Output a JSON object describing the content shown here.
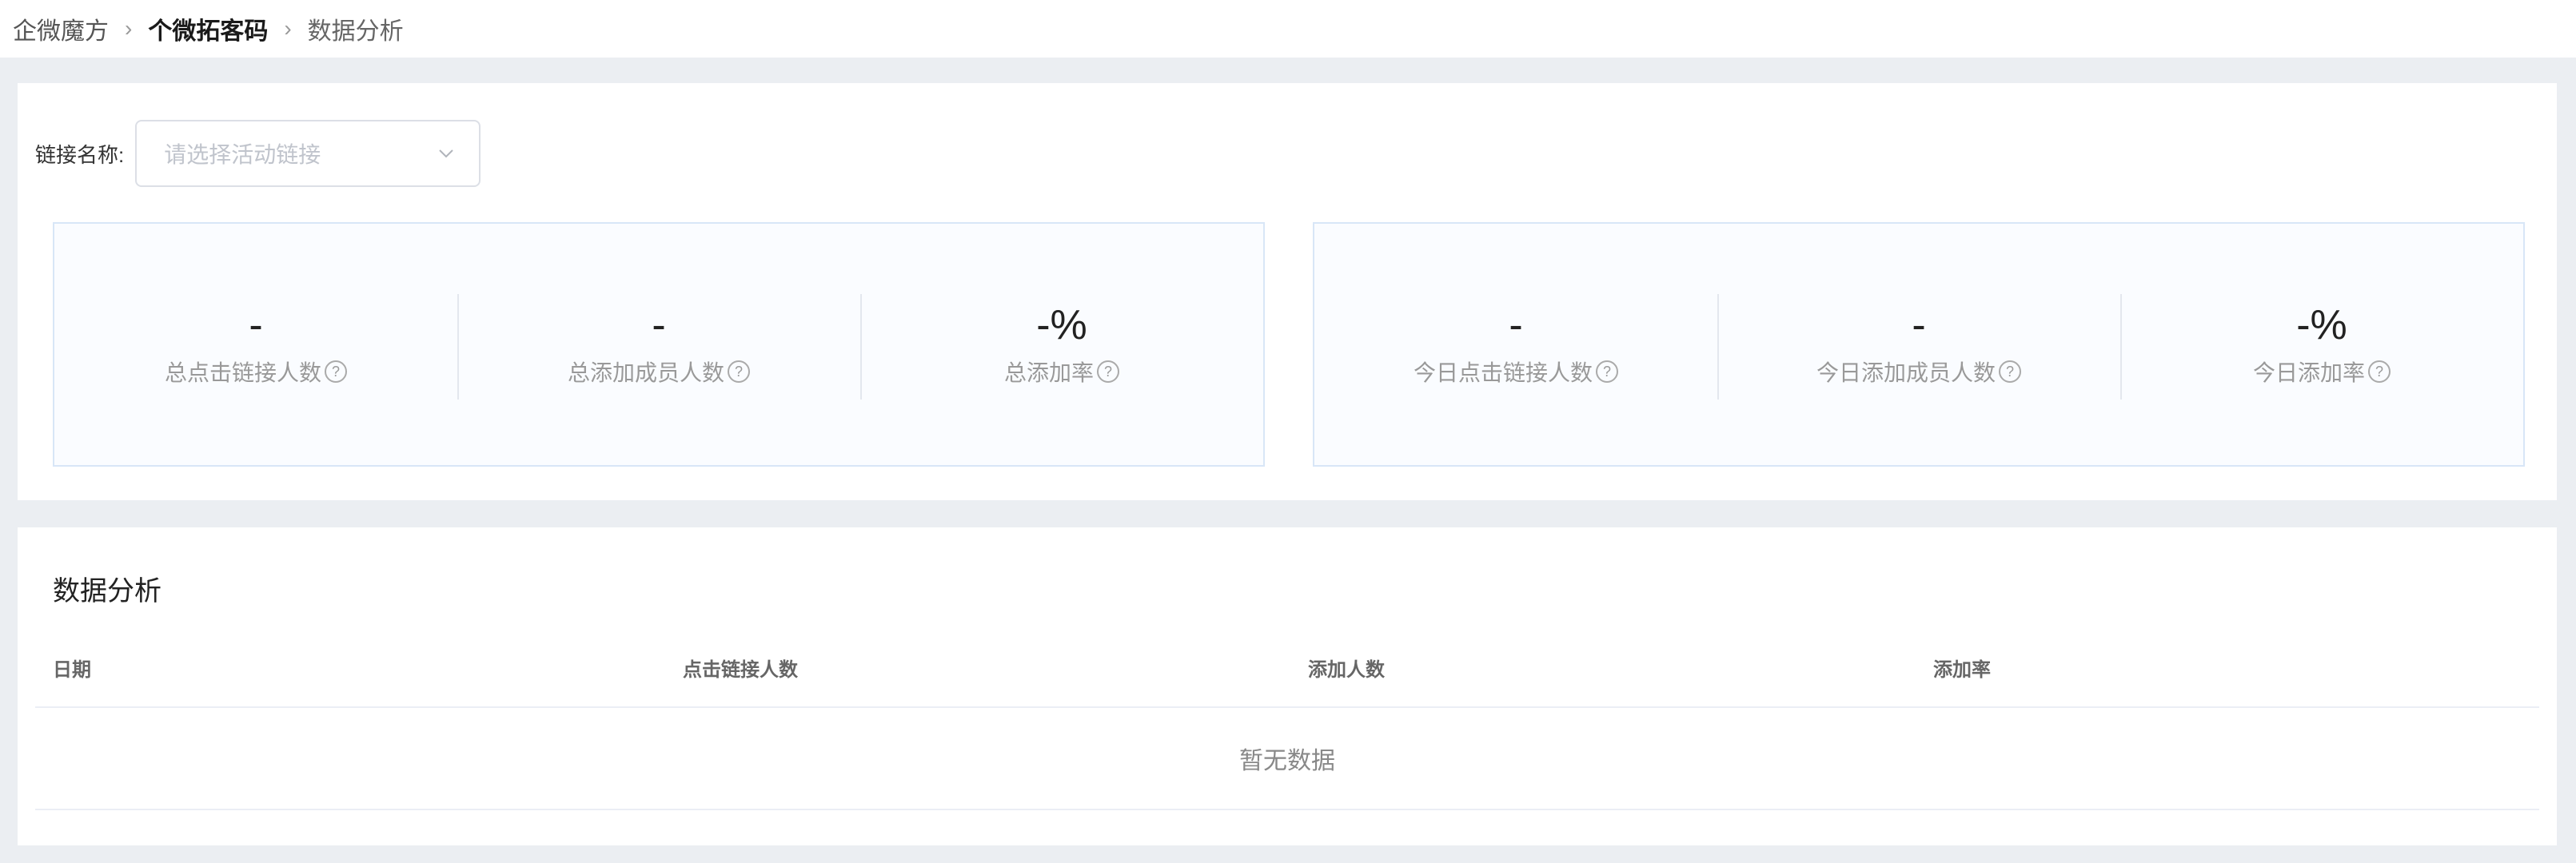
{
  "breadcrumb": {
    "items": [
      "企微魔方",
      "个微拓客码",
      "数据分析"
    ]
  },
  "filter": {
    "label": "链接名称:",
    "placeholder": "请选择活动链接"
  },
  "stats": {
    "total": [
      {
        "value": "-",
        "label": "总点击链接人数"
      },
      {
        "value": "-",
        "label": "总添加成员人数"
      },
      {
        "value": "-%",
        "label": "总添加率"
      }
    ],
    "today": [
      {
        "value": "-",
        "label": "今日点击链接人数"
      },
      {
        "value": "-",
        "label": "今日添加成员人数"
      },
      {
        "value": "-%",
        "label": "今日添加率"
      }
    ]
  },
  "analysis": {
    "title": "数据分析",
    "columns": [
      "日期",
      "点击链接人数",
      "添加人数",
      "添加率"
    ],
    "empty_text": "暂无数据"
  },
  "icons": {
    "help": "help-circle-icon",
    "chevron": "chevron-down-icon",
    "separator": "chevron-right-icon"
  }
}
